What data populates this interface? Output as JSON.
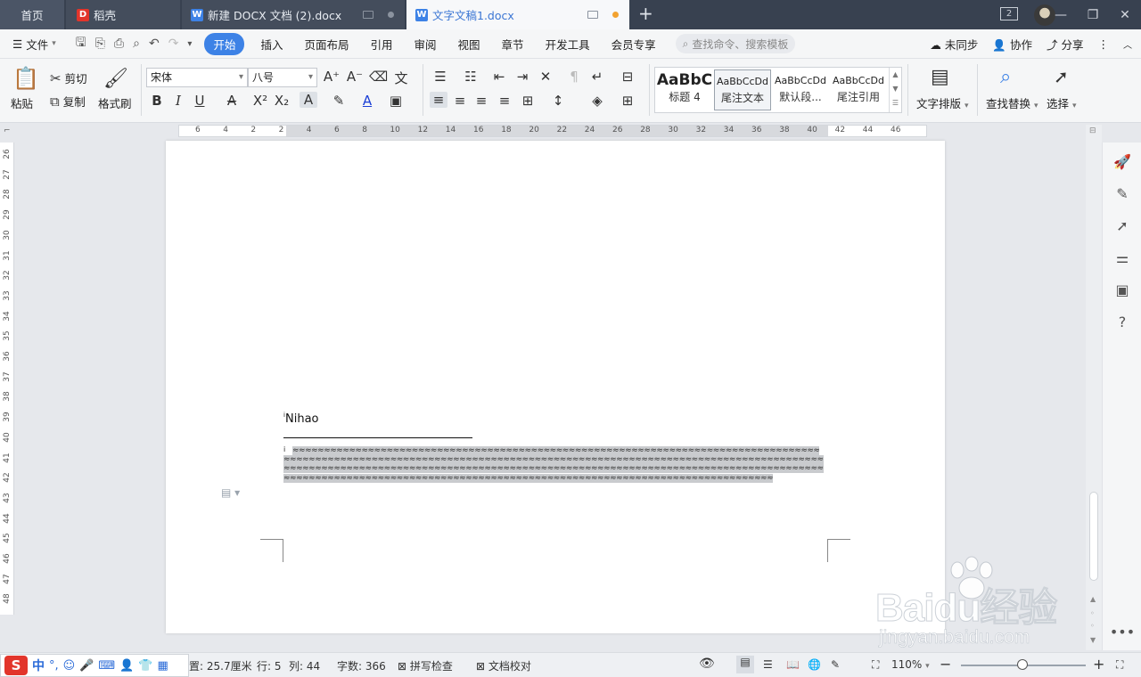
{
  "titlebar": {
    "tabs": [
      {
        "label": "首页"
      },
      {
        "label": "稻壳"
      },
      {
        "label": "新建 DOCX 文档 (2).docx"
      },
      {
        "label": "文字文稿1.docx"
      }
    ],
    "add_tab": "+",
    "window_count": "2"
  },
  "menubar": {
    "file": "文件",
    "items": [
      "开始",
      "插入",
      "页面布局",
      "引用",
      "审阅",
      "视图",
      "章节",
      "开发工具",
      "会员专享"
    ],
    "search_placeholder": "查找命令、搜索模板",
    "right": [
      "未同步",
      "协作",
      "分享"
    ]
  },
  "ribbon": {
    "paste": "粘贴",
    "cut": "剪切",
    "copy": "复制",
    "format_painter": "格式刷",
    "font_name": "宋体",
    "font_size": "八号",
    "styles": [
      {
        "preview": "AaBbC",
        "name": "标题 4"
      },
      {
        "preview": "AaBbCcDd",
        "name": "尾注文本"
      },
      {
        "preview": "AaBbCcDd",
        "name": "默认段..."
      },
      {
        "preview": "AaBbCcDd",
        "name": "尾注引用"
      }
    ],
    "text_layout": "文字排版",
    "find_replace": "查找替换",
    "select": "选择"
  },
  "ruler": {
    "h_ticks": [
      "6",
      "4",
      "2",
      "2",
      "4",
      "6",
      "8",
      "10",
      "12",
      "14",
      "16",
      "18",
      "20",
      "22",
      "24",
      "26",
      "28",
      "30",
      "32",
      "34",
      "36",
      "38",
      "40",
      "42",
      "44",
      "46"
    ],
    "v_ticks": [
      "26",
      "27",
      "28",
      "29",
      "30",
      "31",
      "32",
      "33",
      "34",
      "35",
      "36",
      "37",
      "38",
      "39",
      "40",
      "41",
      "42",
      "43",
      "44",
      "45",
      "46",
      "47",
      "48"
    ]
  },
  "document": {
    "marker": "i",
    "heading": "Nihao",
    "footnote_marker": "i",
    "footnote_text": "≈≈≈≈≈≈≈≈≈≈≈≈≈≈≈≈≈≈≈≈≈≈≈≈≈≈≈≈≈≈≈≈≈≈≈≈≈≈≈≈≈≈≈≈≈≈≈≈≈≈≈≈≈≈≈≈≈≈≈≈≈≈≈≈≈≈≈≈≈≈≈≈≈≈≈≈≈≈≈≈≈≈≈≈≈≈≈≈≈≈≈≈≈≈≈≈≈≈≈≈≈≈≈≈≈≈≈≈≈≈≈≈≈≈≈≈≈≈≈≈≈≈≈≈≈≈≈≈≈≈≈≈≈≈≈≈≈≈≈≈≈≈≈≈≈≈≈≈≈≈≈≈≈≈≈≈≈≈≈≈≈≈≈≈≈≈≈≈≈≈≈≈≈≈≈≈≈≈≈≈≈≈≈≈≈≈≈≈≈≈≈≈≈≈≈≈≈≈≈≈≈≈≈≈≈≈≈≈≈≈≈≈≈≈≈≈≈≈≈≈≈≈≈≈≈≈≈≈≈≈≈≈≈≈≈≈≈≈≈≈≈≈≈≈≈≈≈≈≈≈≈≈≈≈≈≈≈≈≈≈≈≈≈≈≈≈≈≈≈≈≈≈≈≈≈≈≈≈≈≈≈≈≈≈≈≈≈≈≈≈≈≈≈≈≈≈≈≈≈≈≈≈≈≈≈≈≈≈≈≈≈≈≈≈≈≈≈≈≈≈≈≈≈≈≈≈≈≈≈≈≈≈≈≈"
  },
  "statusbar": {
    "position": "置: 25.7厘米",
    "line": "行: 5",
    "column": "列: 44",
    "word_count": "字数: 366",
    "spell_check": "拼写检查",
    "doc_proof": "文档校对",
    "zoom": "110%"
  },
  "ime": {
    "mode": "中"
  },
  "watermark": {
    "main": "Baidu经验",
    "sub": "jingyan.baidu.com"
  },
  "colors": {
    "accent": "#3d82e6",
    "titlebar": "#384150",
    "active_tab_text": "#3b76d4"
  }
}
